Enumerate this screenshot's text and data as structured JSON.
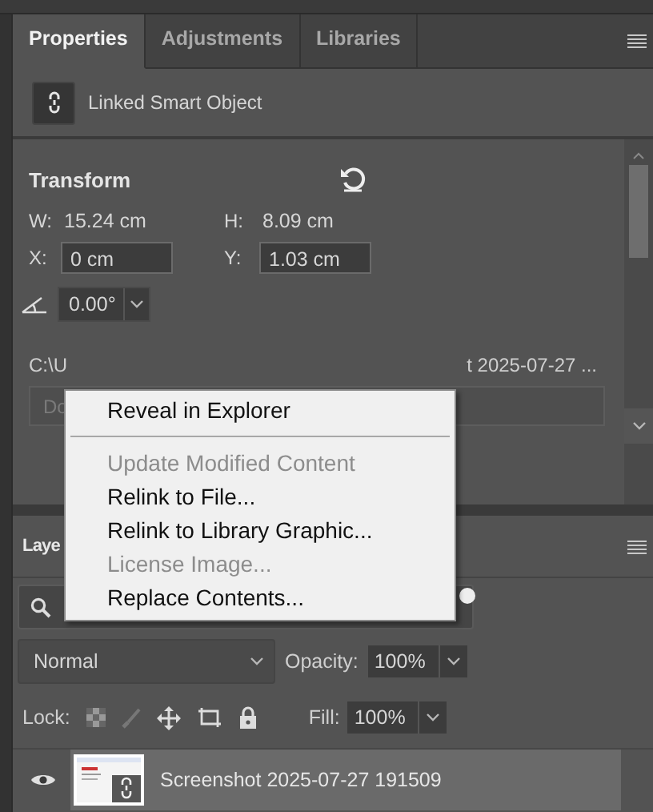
{
  "tabs": [
    {
      "label": "Properties",
      "selected": true
    },
    {
      "label": "Adjustments",
      "selected": false
    },
    {
      "label": "Libraries",
      "selected": false
    }
  ],
  "object_type": {
    "label": "Linked Smart Object"
  },
  "transform": {
    "title": "Transform",
    "w_label": "W:",
    "w_value": "15.24 cm",
    "h_label": "H:",
    "h_value": "8.09 cm",
    "x_label": "X:",
    "x_value": "0 cm",
    "y_label": "Y:",
    "y_value": "1.03 cm",
    "angle_value": "0.00°"
  },
  "link": {
    "path_start": "C:\\U",
    "path_end": "t 2025-07-27 ...",
    "dropdown": "Do"
  },
  "layers": {
    "title": "Laye",
    "blend_mode": "Normal",
    "opacity_label": "Opacity:",
    "opacity": "100%",
    "lock_label": "Lock:",
    "fill_label": "Fill:",
    "fill": "100%",
    "rows": [
      {
        "name": "Screenshot 2025-07-27 191509",
        "visible": true,
        "selected": true
      }
    ]
  },
  "context_menu": {
    "items": [
      {
        "kind": "item",
        "label": "Reveal in Explorer",
        "disabled": false
      },
      {
        "kind": "separator"
      },
      {
        "kind": "item",
        "label": "Update Modified Content",
        "disabled": true
      },
      {
        "kind": "item",
        "label": "Relink to File...",
        "disabled": false
      },
      {
        "kind": "item",
        "label": "Relink to Library Graphic...",
        "disabled": false
      },
      {
        "kind": "item",
        "label": "License Image...",
        "disabled": true
      },
      {
        "kind": "item",
        "label": "Replace Contents...",
        "disabled": false
      }
    ]
  }
}
